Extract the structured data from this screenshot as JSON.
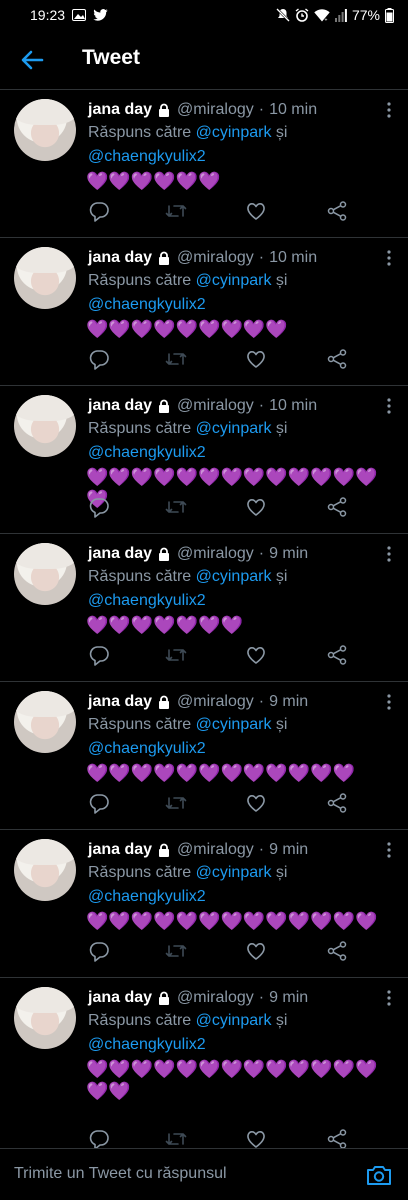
{
  "status_bar": {
    "time": "19:23",
    "battery": "77%",
    "icons": [
      "gallery-icon",
      "twitter-icon",
      "mute-icon",
      "alarm-icon",
      "wifi-icon",
      "signal-icon",
      "battery-icon"
    ]
  },
  "header": {
    "title": "Tweet",
    "back_icon": "arrow-left-icon"
  },
  "tweets": [
    {
      "name": "jana day",
      "handle": "@miralogy",
      "sep": "·",
      "time": "10 min",
      "reply_prefix": "Răspuns către",
      "mention1": "@cyinpark",
      "conj": "și",
      "mention2": "@chaengkyulix2",
      "hearts": "💜💜💜💜💜💜"
    },
    {
      "name": "jana day",
      "handle": "@miralogy",
      "sep": "·",
      "time": "10 min",
      "reply_prefix": "Răspuns către",
      "mention1": "@cyinpark",
      "conj": "și",
      "mention2": "@chaengkyulix2",
      "hearts": "💜💜💜💜💜💜💜💜💜"
    },
    {
      "name": "jana day",
      "handle": "@miralogy",
      "sep": "·",
      "time": "10 min",
      "reply_prefix": "Răspuns către",
      "mention1": "@cyinpark",
      "conj": "și",
      "mention2": "@chaengkyulix2",
      "hearts": "💜💜💜💜💜💜💜💜💜💜💜💜💜💜"
    },
    {
      "name": "jana day",
      "handle": "@miralogy",
      "sep": "·",
      "time": "9 min",
      "reply_prefix": "Răspuns către",
      "mention1": "@cyinpark",
      "conj": "și",
      "mention2": "@chaengkyulix2",
      "hearts": "💜💜💜💜💜💜💜"
    },
    {
      "name": "jana day",
      "handle": "@miralogy",
      "sep": "·",
      "time": "9 min",
      "reply_prefix": "Răspuns către",
      "mention1": "@cyinpark",
      "conj": "și",
      "mention2": "@chaengkyulix2",
      "hearts": "💜💜💜💜💜💜💜💜💜💜💜💜"
    },
    {
      "name": "jana day",
      "handle": "@miralogy",
      "sep": "·",
      "time": "9 min",
      "reply_prefix": "Răspuns către",
      "mention1": "@cyinpark",
      "conj": "și",
      "mention2": "@chaengkyulix2",
      "hearts": "💜💜💜💜💜💜💜💜💜💜💜💜💜"
    },
    {
      "name": "jana day",
      "handle": "@miralogy",
      "sep": "·",
      "time": "9 min",
      "reply_prefix": "Răspuns către",
      "mention1": "@cyinpark",
      "conj": "și",
      "mention2": "@chaengkyulix2",
      "hearts": "💜💜💜💜💜💜💜💜💜💜💜💜💜💜💜"
    }
  ],
  "composer": {
    "placeholder": "Trimite un Tweet cu răspunsul",
    "camera_icon": "camera-icon"
  },
  "colors": {
    "background": "#000000",
    "accent": "#1d9bf0",
    "muted": "#8b98a5",
    "heart": "#b39ddb"
  }
}
